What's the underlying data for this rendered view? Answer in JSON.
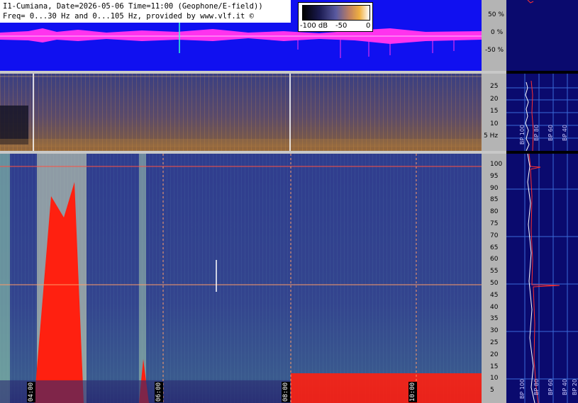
{
  "header": {
    "line1": "I1-Cumiana, Date=2026-05-06 Time=11:00 (Geophone/E-field))",
    "line2": "Freq= 0...30 Hz and 0...105 Hz, provided by www.vlf.it ©"
  },
  "legend": {
    "low": "-100 dB",
    "mid": "-50",
    "high": "0"
  },
  "amplitude_scale": [
    "50 %",
    "0 %",
    "-50 %"
  ],
  "mid_freq_scale": [
    "25",
    "20",
    "15",
    "10",
    "5 Hz"
  ],
  "low_freq_scale": [
    "100",
    "95",
    "90",
    "85",
    "80",
    "75",
    "70",
    "65",
    "60",
    "55",
    "50",
    "45",
    "40",
    "35",
    "30",
    "25",
    "20",
    "15",
    "10",
    "5"
  ],
  "time_labels": [
    "04:00",
    "06:00",
    "08:00",
    "10:00"
  ],
  "profile_labels": [
    "BP 100",
    "BP 80",
    "BP 60",
    "BP 40",
    "BP 20"
  ],
  "colors": {
    "wave_bg": "#1010f0",
    "wave": "#ff33ee",
    "marker": "#ff8866",
    "profile_bg": "#0a0a6e"
  }
}
